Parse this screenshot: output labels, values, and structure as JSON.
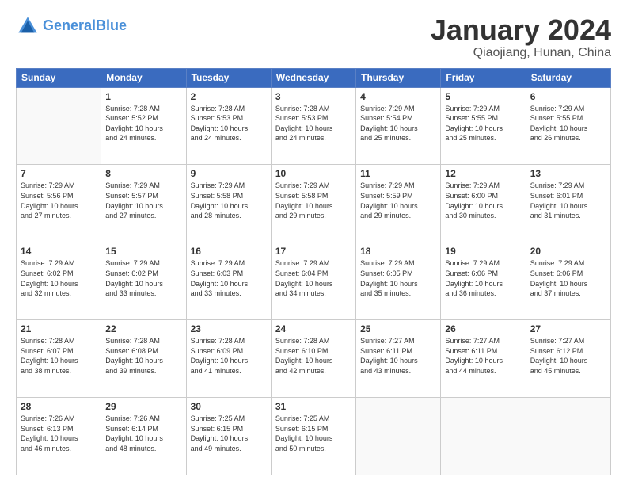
{
  "header": {
    "logo_general": "General",
    "logo_blue": "Blue",
    "month_title": "January 2024",
    "location": "Qiaojiang, Hunan, China"
  },
  "days_of_week": [
    "Sunday",
    "Monday",
    "Tuesday",
    "Wednesday",
    "Thursday",
    "Friday",
    "Saturday"
  ],
  "weeks": [
    [
      {
        "day": "",
        "info": ""
      },
      {
        "day": "1",
        "info": "Sunrise: 7:28 AM\nSunset: 5:52 PM\nDaylight: 10 hours\nand 24 minutes."
      },
      {
        "day": "2",
        "info": "Sunrise: 7:28 AM\nSunset: 5:53 PM\nDaylight: 10 hours\nand 24 minutes."
      },
      {
        "day": "3",
        "info": "Sunrise: 7:28 AM\nSunset: 5:53 PM\nDaylight: 10 hours\nand 24 minutes."
      },
      {
        "day": "4",
        "info": "Sunrise: 7:29 AM\nSunset: 5:54 PM\nDaylight: 10 hours\nand 25 minutes."
      },
      {
        "day": "5",
        "info": "Sunrise: 7:29 AM\nSunset: 5:55 PM\nDaylight: 10 hours\nand 25 minutes."
      },
      {
        "day": "6",
        "info": "Sunrise: 7:29 AM\nSunset: 5:55 PM\nDaylight: 10 hours\nand 26 minutes."
      }
    ],
    [
      {
        "day": "7",
        "info": "Sunrise: 7:29 AM\nSunset: 5:56 PM\nDaylight: 10 hours\nand 27 minutes."
      },
      {
        "day": "8",
        "info": "Sunrise: 7:29 AM\nSunset: 5:57 PM\nDaylight: 10 hours\nand 27 minutes."
      },
      {
        "day": "9",
        "info": "Sunrise: 7:29 AM\nSunset: 5:58 PM\nDaylight: 10 hours\nand 28 minutes."
      },
      {
        "day": "10",
        "info": "Sunrise: 7:29 AM\nSunset: 5:58 PM\nDaylight: 10 hours\nand 29 minutes."
      },
      {
        "day": "11",
        "info": "Sunrise: 7:29 AM\nSunset: 5:59 PM\nDaylight: 10 hours\nand 29 minutes."
      },
      {
        "day": "12",
        "info": "Sunrise: 7:29 AM\nSunset: 6:00 PM\nDaylight: 10 hours\nand 30 minutes."
      },
      {
        "day": "13",
        "info": "Sunrise: 7:29 AM\nSunset: 6:01 PM\nDaylight: 10 hours\nand 31 minutes."
      }
    ],
    [
      {
        "day": "14",
        "info": "Sunrise: 7:29 AM\nSunset: 6:02 PM\nDaylight: 10 hours\nand 32 minutes."
      },
      {
        "day": "15",
        "info": "Sunrise: 7:29 AM\nSunset: 6:02 PM\nDaylight: 10 hours\nand 33 minutes."
      },
      {
        "day": "16",
        "info": "Sunrise: 7:29 AM\nSunset: 6:03 PM\nDaylight: 10 hours\nand 33 minutes."
      },
      {
        "day": "17",
        "info": "Sunrise: 7:29 AM\nSunset: 6:04 PM\nDaylight: 10 hours\nand 34 minutes."
      },
      {
        "day": "18",
        "info": "Sunrise: 7:29 AM\nSunset: 6:05 PM\nDaylight: 10 hours\nand 35 minutes."
      },
      {
        "day": "19",
        "info": "Sunrise: 7:29 AM\nSunset: 6:06 PM\nDaylight: 10 hours\nand 36 minutes."
      },
      {
        "day": "20",
        "info": "Sunrise: 7:29 AM\nSunset: 6:06 PM\nDaylight: 10 hours\nand 37 minutes."
      }
    ],
    [
      {
        "day": "21",
        "info": "Sunrise: 7:28 AM\nSunset: 6:07 PM\nDaylight: 10 hours\nand 38 minutes."
      },
      {
        "day": "22",
        "info": "Sunrise: 7:28 AM\nSunset: 6:08 PM\nDaylight: 10 hours\nand 39 minutes."
      },
      {
        "day": "23",
        "info": "Sunrise: 7:28 AM\nSunset: 6:09 PM\nDaylight: 10 hours\nand 41 minutes."
      },
      {
        "day": "24",
        "info": "Sunrise: 7:28 AM\nSunset: 6:10 PM\nDaylight: 10 hours\nand 42 minutes."
      },
      {
        "day": "25",
        "info": "Sunrise: 7:27 AM\nSunset: 6:11 PM\nDaylight: 10 hours\nand 43 minutes."
      },
      {
        "day": "26",
        "info": "Sunrise: 7:27 AM\nSunset: 6:11 PM\nDaylight: 10 hours\nand 44 minutes."
      },
      {
        "day": "27",
        "info": "Sunrise: 7:27 AM\nSunset: 6:12 PM\nDaylight: 10 hours\nand 45 minutes."
      }
    ],
    [
      {
        "day": "28",
        "info": "Sunrise: 7:26 AM\nSunset: 6:13 PM\nDaylight: 10 hours\nand 46 minutes."
      },
      {
        "day": "29",
        "info": "Sunrise: 7:26 AM\nSunset: 6:14 PM\nDaylight: 10 hours\nand 48 minutes."
      },
      {
        "day": "30",
        "info": "Sunrise: 7:25 AM\nSunset: 6:15 PM\nDaylight: 10 hours\nand 49 minutes."
      },
      {
        "day": "31",
        "info": "Sunrise: 7:25 AM\nSunset: 6:15 PM\nDaylight: 10 hours\nand 50 minutes."
      },
      {
        "day": "",
        "info": ""
      },
      {
        "day": "",
        "info": ""
      },
      {
        "day": "",
        "info": ""
      }
    ]
  ]
}
